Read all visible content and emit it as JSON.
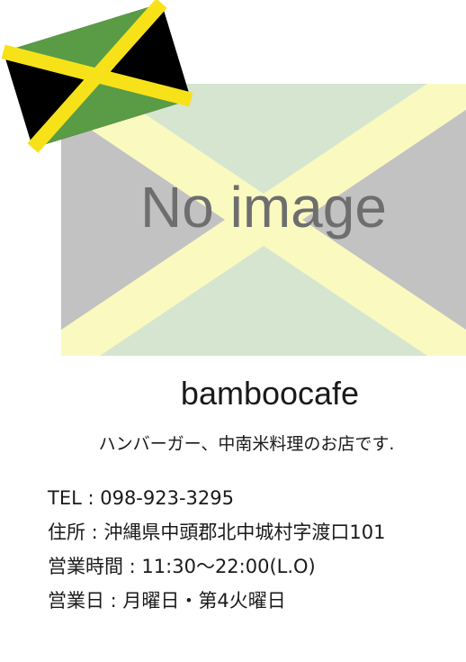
{
  "placeholder": {
    "text": "No image"
  },
  "flag": {
    "icon": "jamaica-flag-icon",
    "colors": {
      "green": "#5a9b45",
      "black": "#000000",
      "yellow": "#f7e21a"
    }
  },
  "shop": {
    "name": "bamboocafe",
    "tagline": "ハンバーガー、中南米料理のお店です."
  },
  "info": {
    "tel": "TEL : 098-923-3295",
    "address": "住所 : 沖縄県中頭郡北中城村字渡口101",
    "hours": "営業時間 : 11:30〜22:00(L.O)",
    "closed": "営業日 : 月曜日・第4火曜日"
  }
}
